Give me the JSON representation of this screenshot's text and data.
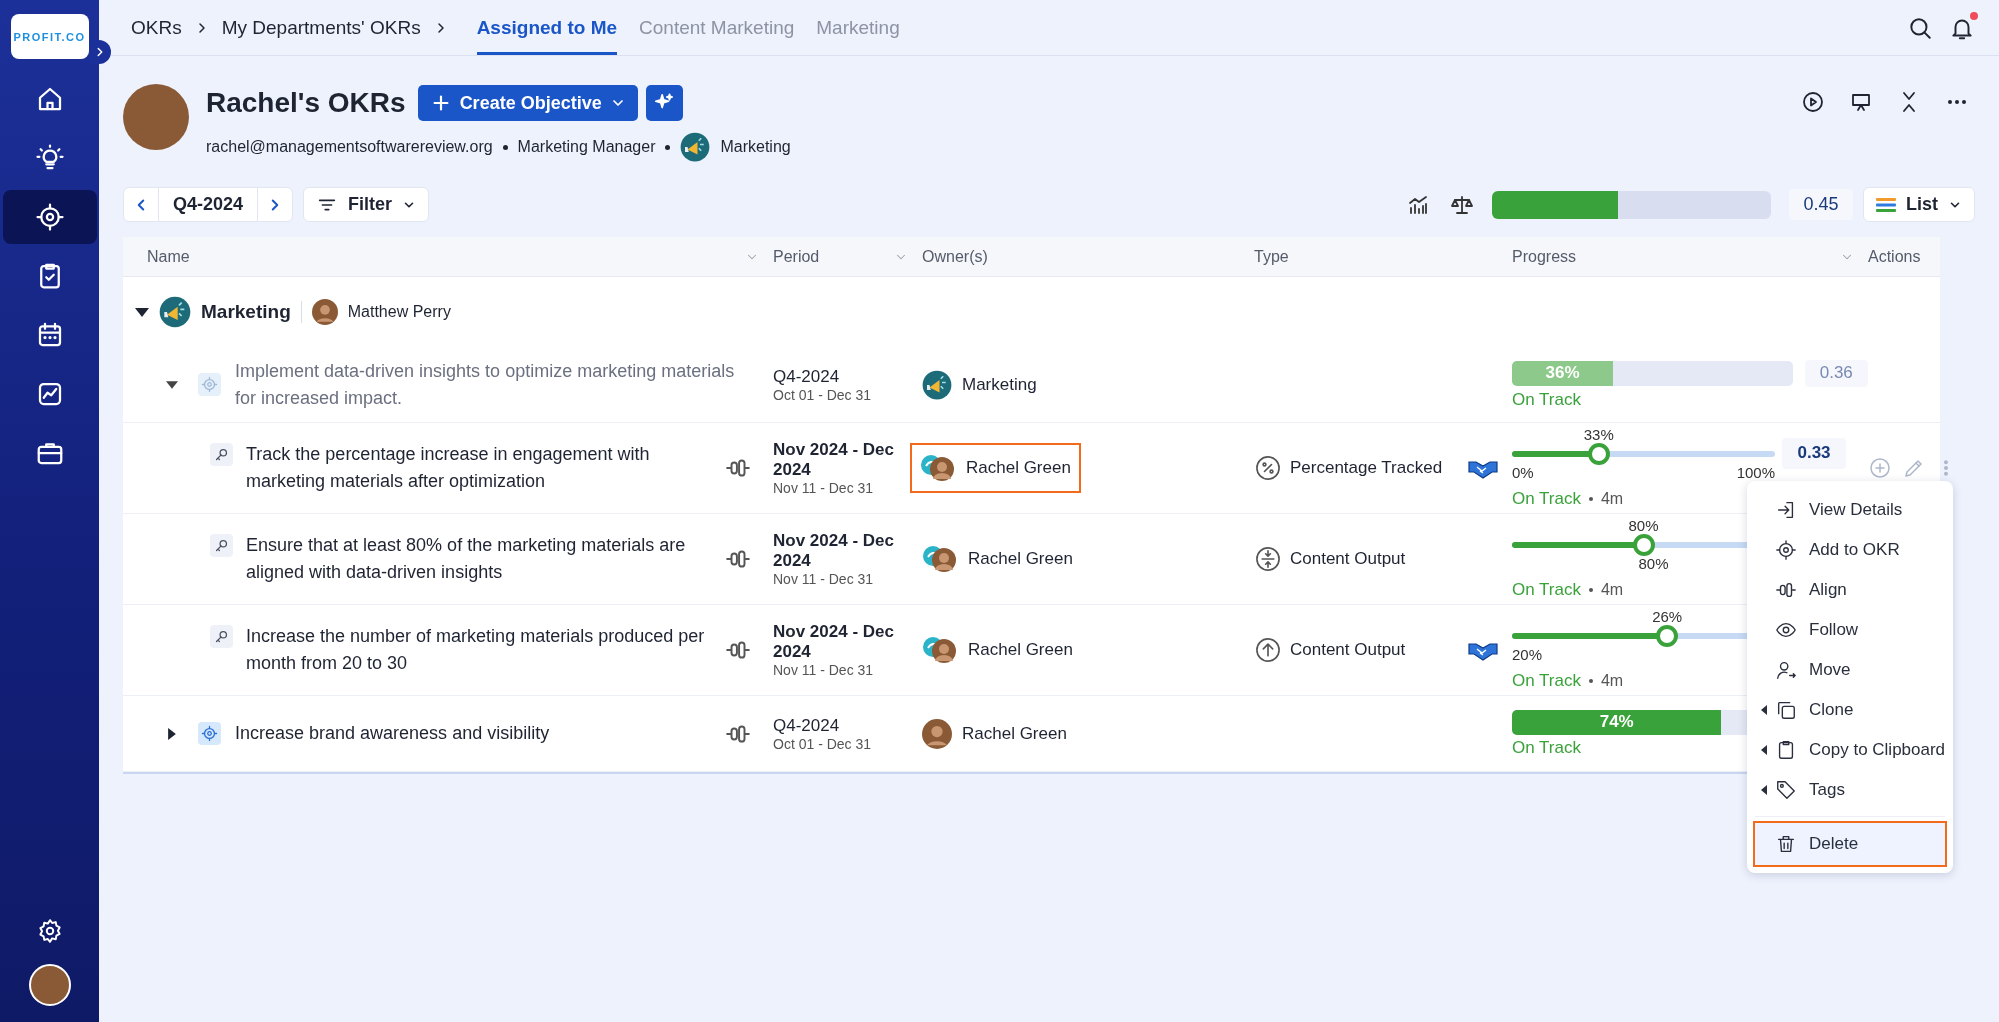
{
  "sidebar": {
    "logo": "PROFIT.CO",
    "items": [
      {
        "kind": "home",
        "selected": false
      },
      {
        "kind": "ideas",
        "selected": false
      },
      {
        "kind": "okrs",
        "selected": true
      },
      {
        "kind": "tasks",
        "selected": false
      },
      {
        "kind": "calendar",
        "selected": false
      },
      {
        "kind": "reports",
        "selected": false
      },
      {
        "kind": "workspace",
        "selected": false
      }
    ]
  },
  "topbar": {
    "breadcrumbs": [
      "OKRs",
      "My Departments' OKRs"
    ],
    "tabs": [
      {
        "label": "Assigned to Me",
        "selected": true
      },
      {
        "label": "Content Marketing",
        "selected": false
      },
      {
        "label": "Marketing",
        "selected": false
      }
    ],
    "notifications": true
  },
  "header": {
    "title": "Rachel's OKRs",
    "create_button": "Create Objective",
    "email": "rachel@managementsoftwarereview.org",
    "role": "Marketing Manager",
    "department": "Marketing"
  },
  "toolbar": {
    "period": "Q4-2024",
    "filter": "Filter",
    "overall": {
      "level": 0.45,
      "value": "0.45"
    },
    "view": "List"
  },
  "table": {
    "columns": [
      {
        "label": "Name",
        "sortable": true
      },
      {
        "label": "Period",
        "sortable": true
      },
      {
        "label": "Owner(s)",
        "sortable": false
      },
      {
        "label": "Type",
        "sortable": false
      },
      {
        "label": "Progress",
        "sortable": true
      },
      {
        "label": "Actions",
        "sortable": false
      }
    ],
    "groups": [
      {
        "name": "Marketing",
        "owner": "Matthew Perry",
        "expanded": true,
        "objectives": [
          {
            "title": "Implement data-driven insights to optimize marketing materials for increased impact.",
            "dimmed": true,
            "expanded": true,
            "alignable": false,
            "period": "Q4-2024",
            "dates": "Oct 01 - Dec 31",
            "owner": {
              "name": "Marketing",
              "kind": "team",
              "highlighted": false
            },
            "progress": {
              "level": 0.36,
              "label": "36%",
              "value": "0.36",
              "status": "On Track"
            },
            "key_results": [
              {
                "title": "Track the percentage increase in engagement with marketing materials after optimization",
                "alignable": true,
                "period": "Nov 2024 - Dec 2024",
                "dates": "Nov 11 - Dec 31",
                "owner": {
                  "name": "Rachel Green",
                  "kind": "team_person",
                  "highlighted": true
                },
                "type": {
                  "label": "Percentage Tracked",
                  "kind": "percent"
                },
                "shared": true,
                "hovered": true,
                "progress": {
                  "level": 0.33,
                  "label": "33%",
                  "start": "0%",
                  "end": "100%",
                  "value": "0.33",
                  "status": "On Track",
                  "updated": "4m"
                }
              },
              {
                "title": "Ensure that at least 80% of the marketing materials are aligned with data-driven insights",
                "alignable": true,
                "period": "Nov 2024 - Dec 2024",
                "dates": "Nov 11 - Dec 31",
                "owner": {
                  "name": "Rachel Green",
                  "kind": "team_person",
                  "highlighted": false
                },
                "type": {
                  "label": "Content Output",
                  "kind": "range"
                },
                "shared": false,
                "hovered": false,
                "progress": {
                  "level": 0.5,
                  "label": "80%",
                  "target": "80%",
                  "status": "On Track",
                  "updated": "4m"
                }
              },
              {
                "title": "Increase the number of marketing materials produced per month from 20 to 30",
                "alignable": true,
                "period": "Nov 2024 - Dec 2024",
                "dates": "Nov 11 - Dec 31",
                "owner": {
                  "name": "Rachel Green",
                  "kind": "team_person",
                  "highlighted": false
                },
                "type": {
                  "label": "Content Output",
                  "kind": "increase"
                },
                "shared": true,
                "hovered": false,
                "progress": {
                  "level": 0.59,
                  "label": "26%",
                  "start": "20%",
                  "status": "On Track",
                  "updated": "4m"
                }
              }
            ]
          },
          {
            "title": "Increase brand awareness and visibility",
            "dimmed": false,
            "expanded": false,
            "alignable": true,
            "period": "Q4-2024",
            "dates": "Oct 01 - Dec 31",
            "owner": {
              "name": "Rachel Green",
              "kind": "person",
              "highlighted": false
            },
            "progress": {
              "level": 0.74,
              "label": "74%",
              "status": "On Track"
            }
          }
        ]
      }
    ]
  },
  "menu": {
    "items": [
      {
        "label": "View Details",
        "kind": "details",
        "submenu": false,
        "separated": false,
        "highlighted": false
      },
      {
        "label": "Add to OKR",
        "kind": "target",
        "submenu": false,
        "separated": false,
        "highlighted": false
      },
      {
        "label": "Align",
        "kind": "align",
        "submenu": false,
        "separated": false,
        "highlighted": false
      },
      {
        "label": "Follow",
        "kind": "follow",
        "submenu": false,
        "separated": false,
        "highlighted": false
      },
      {
        "label": "Move",
        "kind": "move",
        "submenu": false,
        "separated": false,
        "highlighted": false
      },
      {
        "label": "Clone",
        "kind": "clone",
        "submenu": true,
        "separated": false,
        "highlighted": false
      },
      {
        "label": "Copy to Clipboard",
        "kind": "clipboard",
        "submenu": true,
        "separated": false,
        "highlighted": false
      },
      {
        "label": "Tags",
        "kind": "tag",
        "submenu": true,
        "separated": false,
        "highlighted": false
      },
      {
        "label": "Delete",
        "kind": "delete",
        "submenu": false,
        "separated": true,
        "highlighted": true
      }
    ]
  }
}
